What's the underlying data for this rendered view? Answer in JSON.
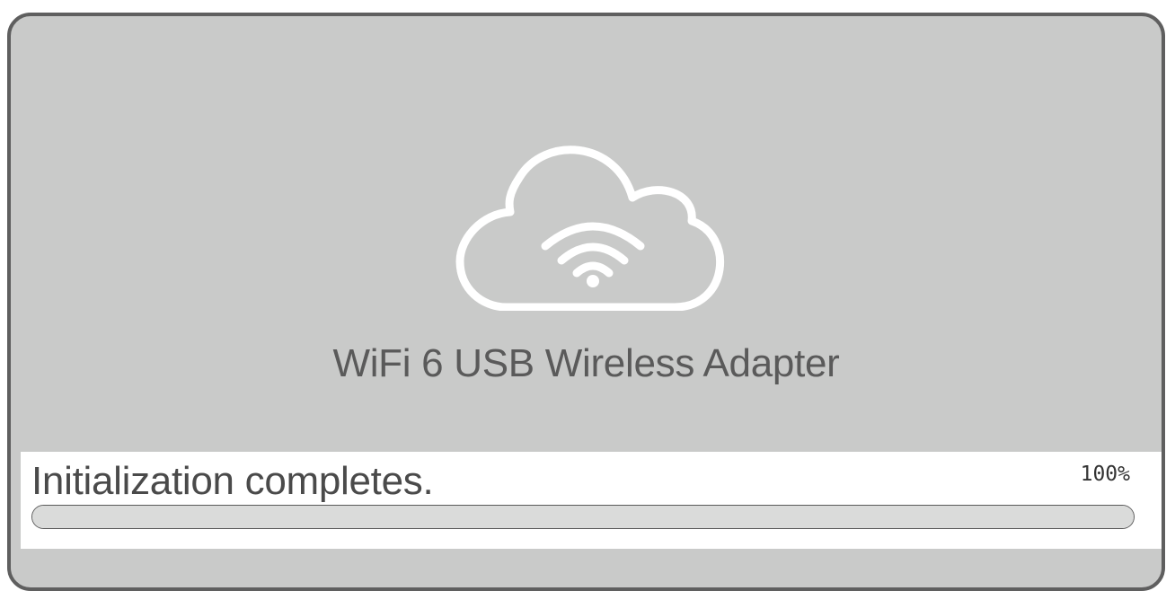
{
  "device": {
    "name": "WiFi 6 USB Wireless Adapter",
    "icon": "cloud-wifi-icon"
  },
  "status": {
    "message": "Initialization completes.",
    "percent_label": "100%",
    "progress_percent": 100
  },
  "colors": {
    "background": "#c9cac9",
    "border": "#5f5f5f",
    "panel": "#ffffff",
    "progress_fill": "#dadbda",
    "icon_stroke": "#ffffff"
  }
}
